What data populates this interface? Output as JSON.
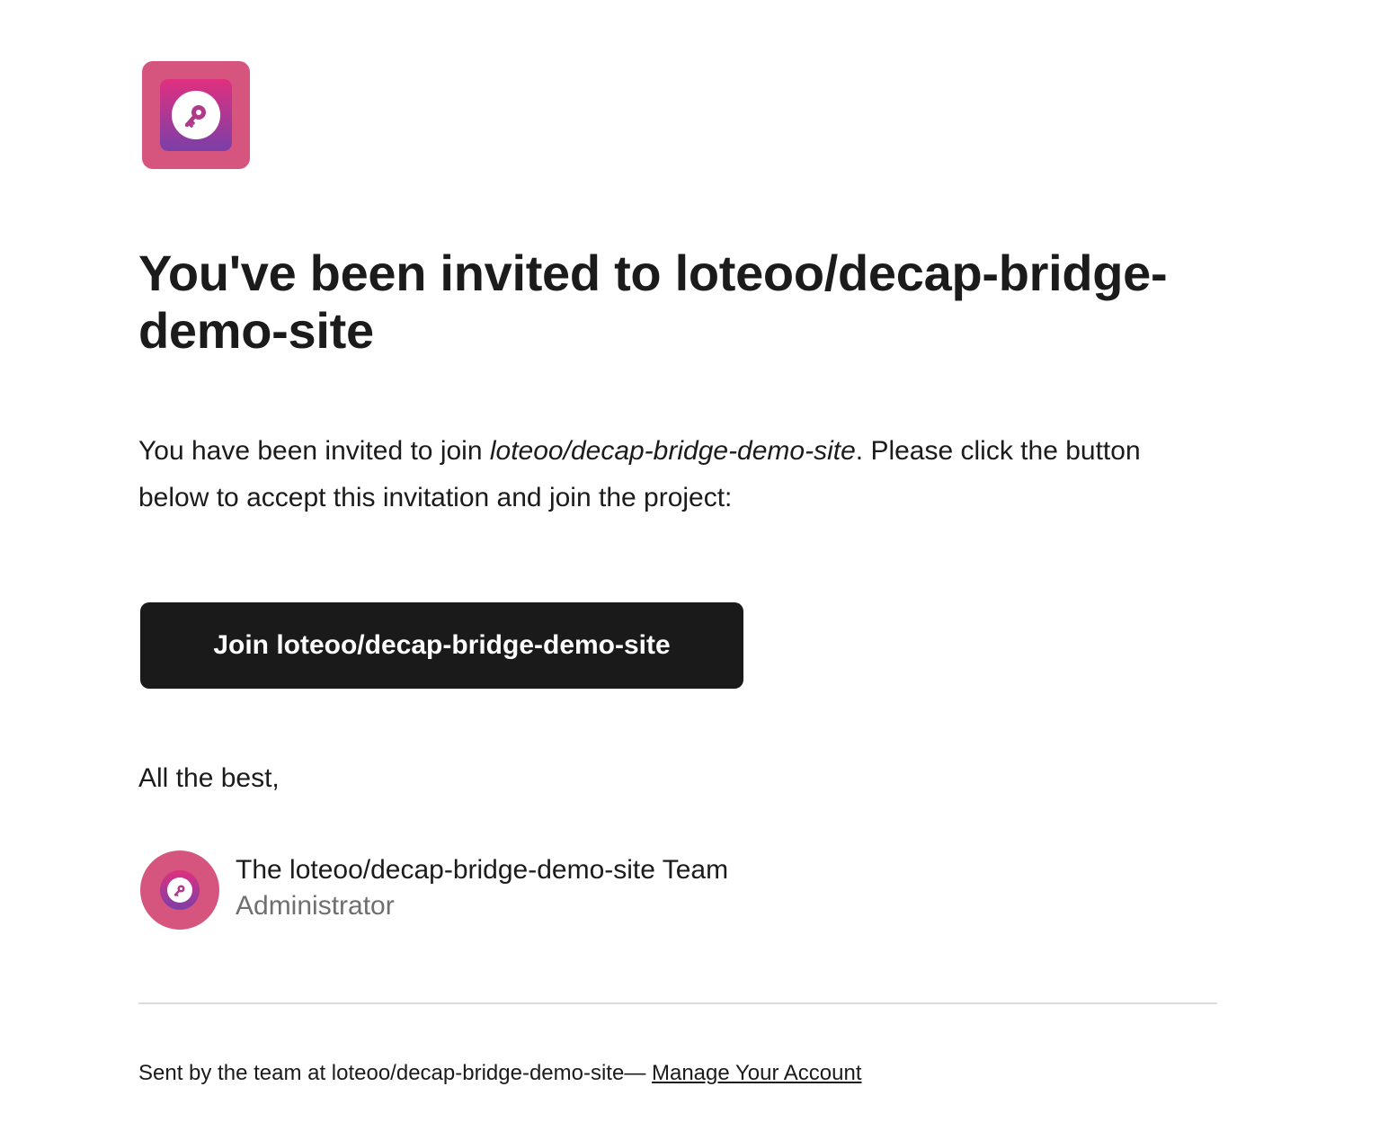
{
  "email": {
    "logo_icon": "key-icon",
    "headline": "You've been invited to loteoo/decap-bridge-demo-site",
    "body": {
      "prefix": "You have been invited to join ",
      "project": "loteoo/decap-bridge-demo-site",
      "suffix": ". Please click the button below to accept this invitation and join the project:"
    },
    "join_button_label": "Join loteoo/decap-bridge-demo-site",
    "signoff": "All the best,",
    "signature": {
      "avatar_icon": "key-icon",
      "team_name": "The loteoo/decap-bridge-demo-site Team",
      "role": "Administrator"
    },
    "footer": {
      "sent_by": "Sent by the team at loteoo/decap-bridge-demo-site— ",
      "manage_link": "Manage Your Account"
    },
    "colors": {
      "brand_pink": "#d6557f",
      "gradient_top": "#e0307f",
      "gradient_bottom": "#7a3fa8",
      "button_bg": "#1a1a1a",
      "text": "#1b1b1b",
      "muted_text": "#6f6f6f"
    }
  }
}
